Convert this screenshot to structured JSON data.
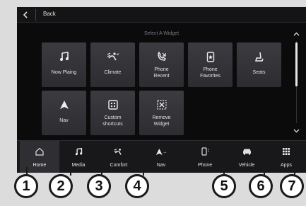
{
  "topbar": {
    "back_label": "Back"
  },
  "section_title": "Select A Widget",
  "widgets": [
    {
      "label": "Now Plaing",
      "icon": "music-note-icon"
    },
    {
      "label": "Climate",
      "icon": "climate-icon"
    },
    {
      "label": "Phone Recent",
      "line1": "Phone",
      "line2": "Recent",
      "icon": "phone-recent-icon"
    },
    {
      "label": "Phone Favorites",
      "line1": "Phone",
      "line2": "Favorites",
      "icon": "phone-favorites-icon"
    },
    {
      "label": "Seats",
      "icon": "seat-icon"
    },
    {
      "label": "Nav",
      "icon": "navigation-arrow-icon"
    },
    {
      "label": "Custom shortcuts",
      "line1": "Custom",
      "line2": "shortcuts",
      "icon": "custom-shortcuts-icon"
    },
    {
      "label": "Remove Widget",
      "line1": "Remove",
      "line2": "Widget",
      "icon": "remove-widget-icon"
    }
  ],
  "nav": [
    {
      "label": "Home",
      "icon": "home-icon",
      "active": true,
      "callout": "1"
    },
    {
      "label": "Media",
      "icon": "music-note-icon",
      "callout": "2"
    },
    {
      "label": "Comfort",
      "icon": "comfort-icon",
      "callout": "3"
    },
    {
      "label": "Nav",
      "icon": "navigation-arrow-icon",
      "callout": "4"
    },
    {
      "label": "Phone",
      "icon": "phone-icon",
      "callout": "5"
    },
    {
      "label": "Vehicle",
      "icon": "vehicle-icon",
      "callout": "6"
    },
    {
      "label": "Apps",
      "icon": "apps-grid-icon",
      "callout": "7"
    }
  ],
  "colors": {
    "screen_bg": "#0b0b0c",
    "tile_bg": "#35353a",
    "text": "#e2e2e2"
  }
}
